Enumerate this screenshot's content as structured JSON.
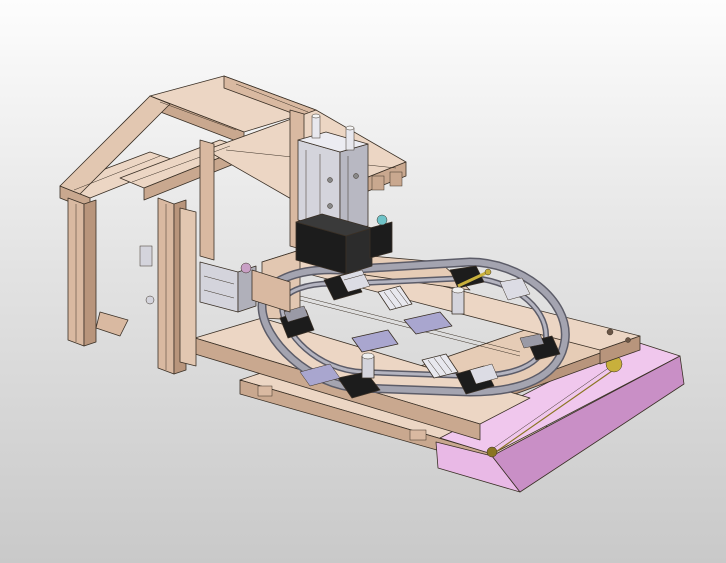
{
  "scene": {
    "subject": "cad-assembly-isometric",
    "colors": {
      "background_top": "#fdfdfd",
      "background_bottom": "#c9c9c9",
      "wood_light": "#ecd6c4",
      "wood_mid": "#d9b9a1",
      "wood_dark": "#b8957c",
      "slot_dark": "#6b5646",
      "track_grey": "#9a9aa6",
      "track_dark": "#5c5c68",
      "block_black": "#1c1c1c",
      "cylinder_silver": "#d4d4dc",
      "pink_panel": "#e9b9e6",
      "pink_dark": "#c98fc6",
      "lavender_plate": "#a9a6cf",
      "screw_gold": "#c8b03c"
    }
  }
}
